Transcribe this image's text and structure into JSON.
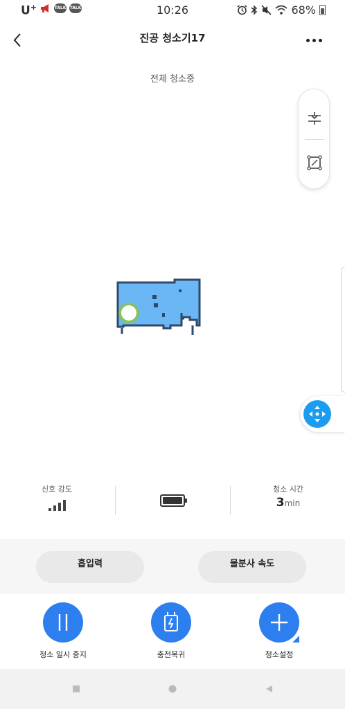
{
  "status_bar": {
    "carrier": "U",
    "carrier_sup": "+",
    "time": "10:26",
    "battery_percent": "68%",
    "talk_icon_text": "TALK"
  },
  "header": {
    "title": "진공 청소기17"
  },
  "map_panel": {
    "status": "전체 청소중"
  },
  "info": {
    "signal_label": "신호 강도",
    "time_label": "청소 시간",
    "time_value": "3",
    "time_unit": "min"
  },
  "settings": {
    "suction_label": "흡입력",
    "water_label": "물분사 속도"
  },
  "actions": {
    "pause_label": "청소 일시 중지",
    "dock_label": "충전복귀",
    "settings_label": "청소설정"
  },
  "colors": {
    "accent_blue": "#2d7ff0",
    "map_fill": "#6bb6f5",
    "map_wall": "#2f4a66",
    "robot_ring": "#8bc34a"
  }
}
